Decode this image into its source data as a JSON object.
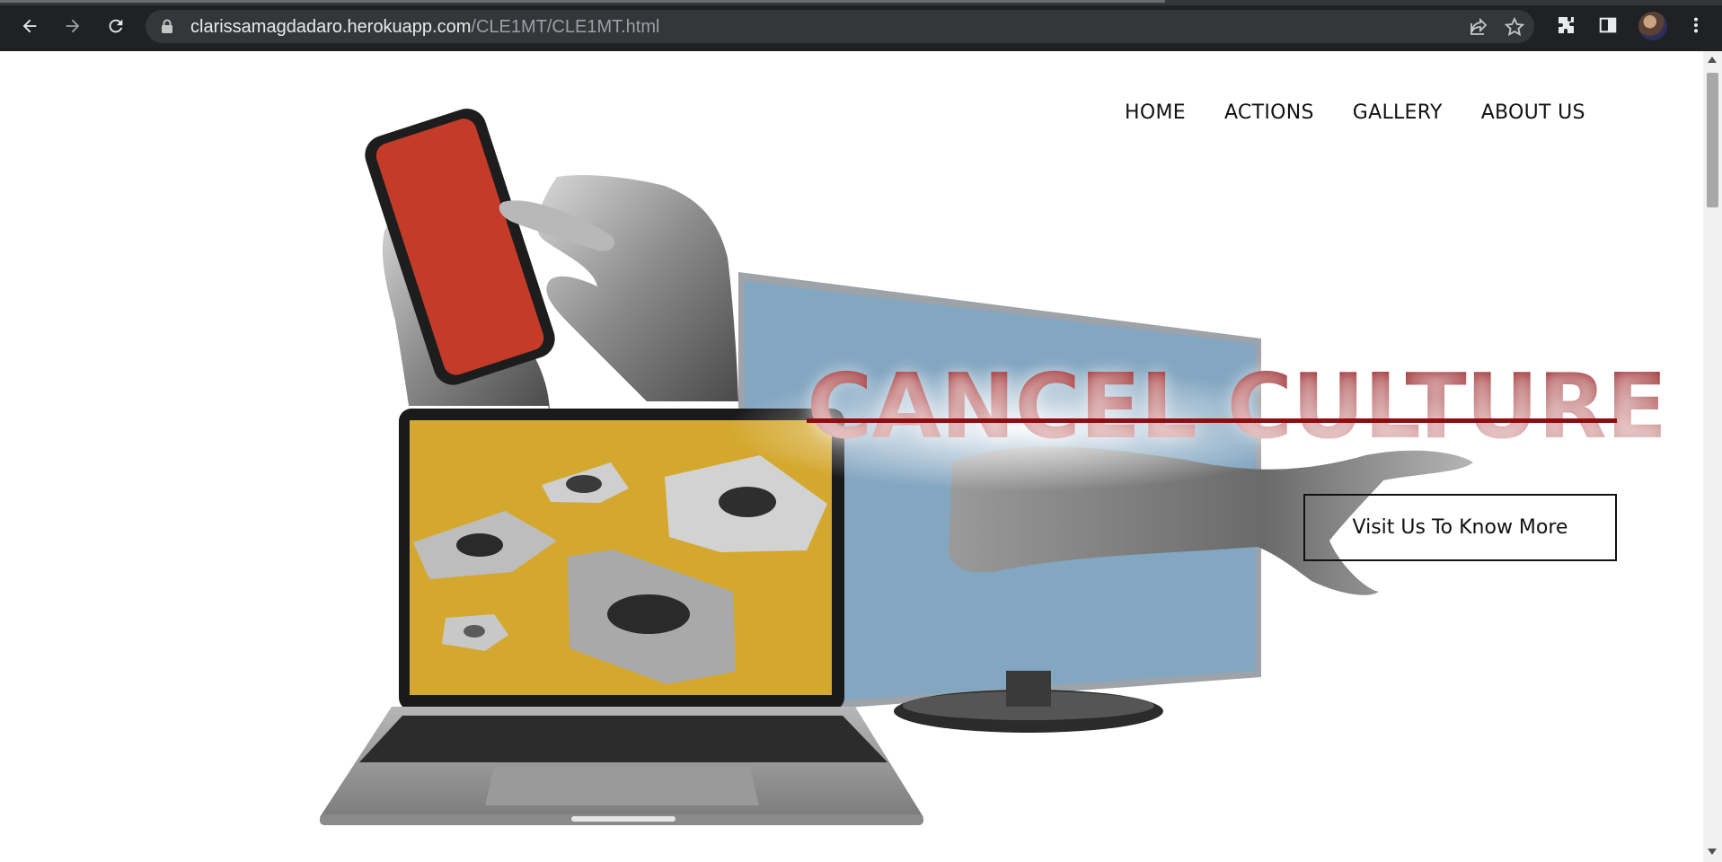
{
  "browser": {
    "url_host": "clarissamagdadaro.herokuapp.com",
    "url_path": "/CLE1MT/CLE1MT.html",
    "icons": [
      "back-icon",
      "forward-icon",
      "reload-icon",
      "lock-icon",
      "share-icon",
      "star-icon",
      "extensions-icon",
      "side-panel-icon",
      "profile-avatar",
      "menu-icon"
    ]
  },
  "nav": {
    "items": [
      {
        "label": "HOME"
      },
      {
        "label": "ACTIONS"
      },
      {
        "label": "GALLERY"
      },
      {
        "label": "ABOUT US"
      }
    ]
  },
  "hero": {
    "title": "CANCEL CULTURE",
    "cta_label": "Visit Us To Know More",
    "colors": {
      "title": "#8e0d10",
      "phone_screen": "#c43b2a",
      "laptop_screen": "#d4a82e",
      "tv_screen": "#83a6c1"
    }
  }
}
